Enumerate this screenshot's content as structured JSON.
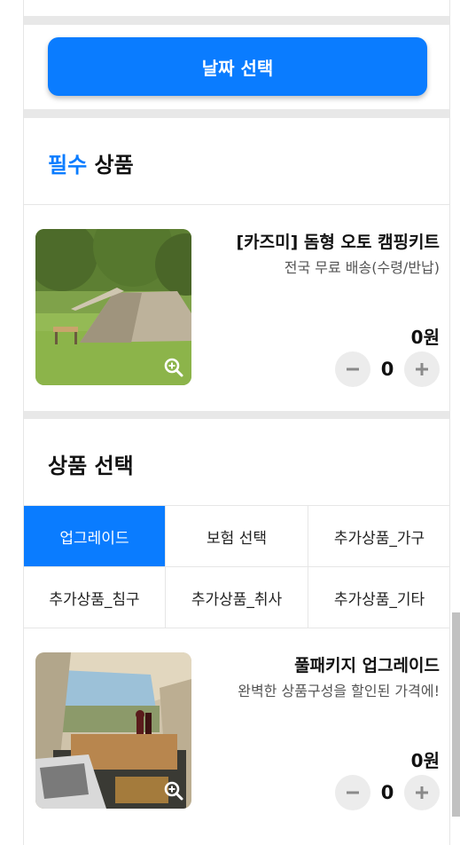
{
  "date_button": {
    "label": "날짜 선택"
  },
  "required_section": {
    "title_accent": "필수",
    "title_rest": " 상품"
  },
  "required_product": {
    "name": "[카즈미] 돔형 오토 캠핑키트",
    "description": "전국 무료 배송(수령/반납)",
    "price": "0원",
    "quantity": "0",
    "image": "camping-tent-photo"
  },
  "select_section": {
    "title": "상품 선택"
  },
  "tabs": [
    {
      "label": "업그레이드",
      "active": true
    },
    {
      "label": "보험 선택",
      "active": false
    },
    {
      "label": "추가상품_가구",
      "active": false
    },
    {
      "label": "추가상품_침구",
      "active": false
    },
    {
      "label": "추가상품_취사",
      "active": false
    },
    {
      "label": "추가상품_기타",
      "active": false
    }
  ],
  "upgrade_product": {
    "name": "풀패키지 업그레이드",
    "description": "완벽한 상품구성을 할인된 가격에!",
    "price": "0원",
    "quantity": "0",
    "image": "tent-interior-photo"
  },
  "colors": {
    "accent": "#0a7cff",
    "divider": "#e8e8e8"
  }
}
